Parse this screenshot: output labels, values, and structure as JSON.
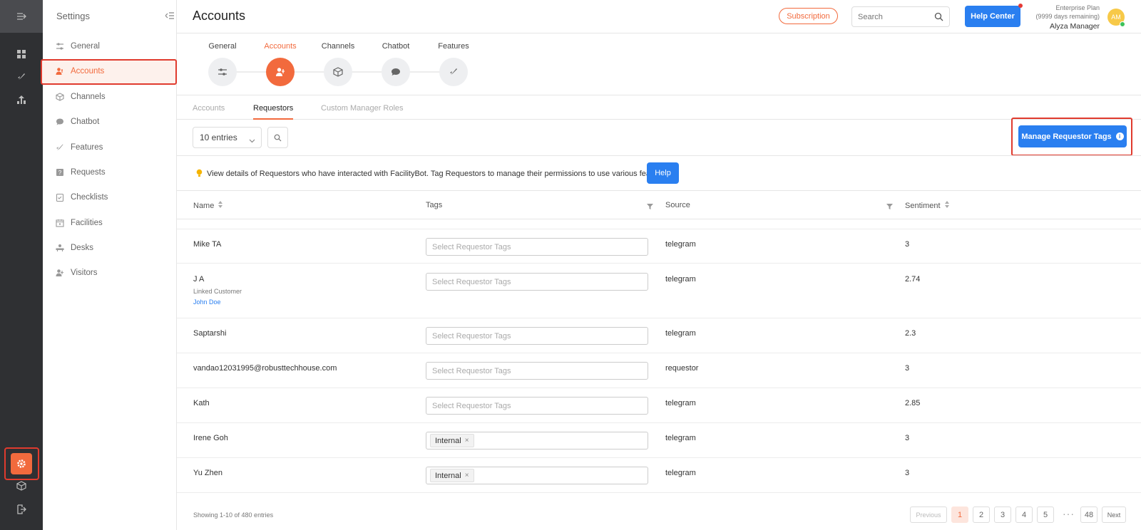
{
  "header": {
    "title": "Accounts",
    "subscription_label": "Subscription",
    "search_placeholder": "Search",
    "help_center_label": "Help Center",
    "plan_name": "Enterprise Plan",
    "plan_days": "(9999 days remaining)",
    "user_name": "Alyza Manager",
    "avatar_initials": "AM"
  },
  "sidebar": {
    "title": "Settings",
    "items": [
      {
        "label": "General",
        "icon": "sliders-icon"
      },
      {
        "label": "Accounts",
        "icon": "users-icon"
      },
      {
        "label": "Channels",
        "icon": "cube-icon"
      },
      {
        "label": "Chatbot",
        "icon": "chat-icon"
      },
      {
        "label": "Features",
        "icon": "rocket-icon"
      },
      {
        "label": "Requests",
        "icon": "question-icon"
      },
      {
        "label": "Checklists",
        "icon": "clipboard-icon"
      },
      {
        "label": "Facilities",
        "icon": "calendar-icon"
      },
      {
        "label": "Desks",
        "icon": "desk-icon"
      },
      {
        "label": "Visitors",
        "icon": "visitor-icon"
      }
    ],
    "active_index": 1
  },
  "steps": [
    {
      "label": "General",
      "icon": "sliders-icon"
    },
    {
      "label": "Accounts",
      "icon": "users-icon"
    },
    {
      "label": "Channels",
      "icon": "cube-icon"
    },
    {
      "label": "Chatbot",
      "icon": "chat-icon"
    },
    {
      "label": "Features",
      "icon": "rocket-icon"
    }
  ],
  "subtabs": [
    {
      "label": "Accounts"
    },
    {
      "label": "Requestors"
    },
    {
      "label": "Custom Manager Roles"
    }
  ],
  "toolbar": {
    "entries_value": "10 entries",
    "manage_tags_label": "Manage Requestor Tags"
  },
  "info": {
    "text": "View details of Requestors who have interacted with FacilityBot. Tag Requestors to manage their permissions to use various features.",
    "help_label": "Help"
  },
  "table": {
    "columns": {
      "name": "Name",
      "tags": "Tags",
      "source": "Source",
      "sentiment": "Sentiment"
    },
    "tag_placeholder": "Select Requestor Tags",
    "rows": [
      {
        "name": "Mike TA",
        "tags": [],
        "source": "telegram",
        "sentiment": "3"
      },
      {
        "name": "J A",
        "linked_label": "Linked Customer",
        "linked_name": "John Doe",
        "tags": [],
        "source": "telegram",
        "sentiment": "2.74"
      },
      {
        "name": "Saptarshi",
        "tags": [],
        "source": "telegram",
        "sentiment": "2.3"
      },
      {
        "name": "vandao12031995@robusttechhouse.com",
        "tags": [],
        "source": "requestor",
        "sentiment": "3"
      },
      {
        "name": "Kath",
        "tags": [],
        "source": "telegram",
        "sentiment": "2.85"
      },
      {
        "name": "Irene Goh",
        "tags": [
          "Internal"
        ],
        "source": "telegram",
        "sentiment": "3"
      },
      {
        "name": "Yu Zhen",
        "tags": [
          "Internal"
        ],
        "source": "telegram",
        "sentiment": "3"
      }
    ]
  },
  "footer": {
    "showing": "Showing 1-10 of 480 entries",
    "previous": "Previous",
    "pages": [
      "1",
      "2",
      "3",
      "4",
      "5"
    ],
    "ellipsis": "···",
    "last_page": "48",
    "next": "Next"
  },
  "colors": {
    "accent": "#f26a3d",
    "primary": "#2a7ff0",
    "highlight_border": "#e03b2e"
  }
}
